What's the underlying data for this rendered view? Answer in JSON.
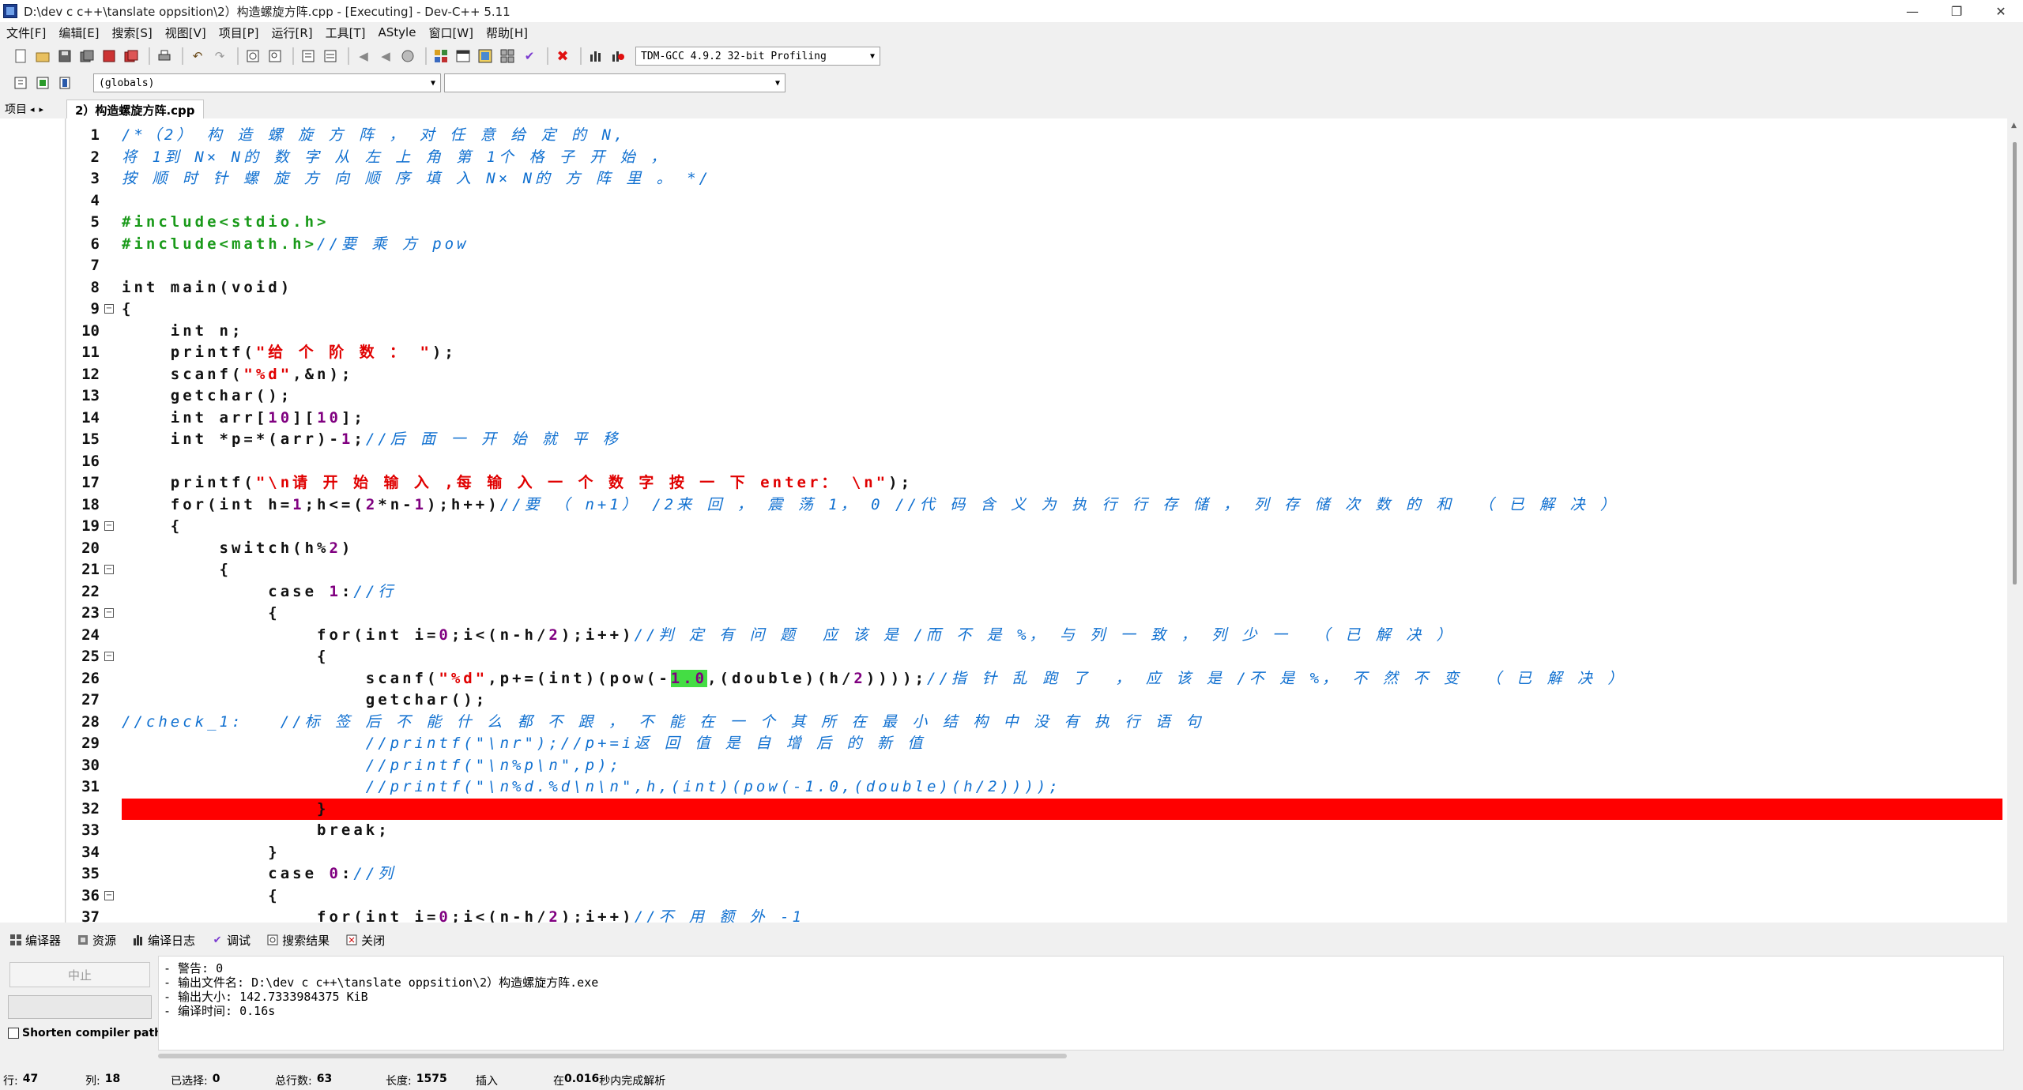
{
  "window": {
    "title": "D:\\dev c c++\\tanslate oppsition\\2）构造螺旋方阵.cpp - [Executing] - Dev-C++ 5.11",
    "minimize": "—",
    "maximize": "❐",
    "close": "✕"
  },
  "menu": [
    "文件[F]",
    "编辑[E]",
    "搜索[S]",
    "视图[V]",
    "项目[P]",
    "运行[R]",
    "工具[T]",
    "AStyle",
    "窗口[W]",
    "帮助[H]"
  ],
  "toolbar": {
    "compiler_select": "TDM-GCC 4.9.2 32-bit Profiling",
    "scope_select": "(globals)",
    "symbol_select": ""
  },
  "left_tabs": {
    "project": "项目",
    "prev": "◂",
    "next": "▸"
  },
  "editor": {
    "file_tab": "2）构造螺旋方阵.cpp",
    "error_line": 32,
    "lines": [
      {
        "n": "1",
        "html": "<span class='cm'>/*（2） 构 造 螺 旋 方 阵 ， 对 任 意 给 定 的 N,</span>"
      },
      {
        "n": "2",
        "html": "<span class='cm'>将 1到 N× N的 数 字 从 左 上 角 第 1个 格 子 开 始 ，</span>"
      },
      {
        "n": "3",
        "html": "<span class='cm'>按 顺 时 针 螺 旋 方 向 顺 序 填 入 N× N的 方 阵 里 。 */</span>"
      },
      {
        "n": "4",
        "html": ""
      },
      {
        "n": "5",
        "html": "<span class='pp'>#include&lt;stdio.h&gt;</span>"
      },
      {
        "n": "6",
        "html": "<span class='pp'>#include&lt;math.h&gt;</span><span class='cm'>//要 乘 方 pow</span>"
      },
      {
        "n": "7",
        "html": ""
      },
      {
        "n": "8",
        "html": "int main(void)"
      },
      {
        "n": "9",
        "html": "{"
      },
      {
        "n": "10",
        "html": "    int n;"
      },
      {
        "n": "11",
        "html": "    printf(<span class='str'>\"给 个 阶 数 ： \"</span>);"
      },
      {
        "n": "12",
        "html": "    scanf(<span class='str'>\"%d\"</span>,&amp;n);"
      },
      {
        "n": "13",
        "html": "    getchar();"
      },
      {
        "n": "14",
        "html": "    int arr[<span class='num'>10</span>][<span class='num'>10</span>];"
      },
      {
        "n": "15",
        "html": "    int *p=*(arr)-<span class='num'>1</span>;<span class='cm'>//后 面 一 开 始 就 平 移</span>"
      },
      {
        "n": "16",
        "html": ""
      },
      {
        "n": "17",
        "html": "    printf(<span class='str'>\"\\n请 开 始 输 入 ,每 输 入 一 个 数 字 按 一 下 enter： \\n\"</span>);"
      },
      {
        "n": "18",
        "html": "    for(int h=<span class='num'>1</span>;h&lt;=(<span class='num'>2</span>*n-<span class='num'>1</span>);h++)<span class='cm'>//要 （ n+1） /2来 回 ， 震 荡 1， 0 //代 码 含 义 为 执 行 行 存 储 ， 列 存 储 次 数 的 和  （ 已 解 决 ）</span>"
      },
      {
        "n": "19",
        "html": "    {"
      },
      {
        "n": "20",
        "html": "        switch(h%<span class='num'>2</span>)"
      },
      {
        "n": "21",
        "html": "        {"
      },
      {
        "n": "22",
        "html": "            case <span class='num'>1</span>:<span class='cm'>//行</span>"
      },
      {
        "n": "23",
        "html": "            {"
      },
      {
        "n": "24",
        "html": "                for(int i=<span class='num'>0</span>;i&lt;(n-h/<span class='num'>2</span>);i++)<span class='cm'>//判 定 有 问 题  应 该 是 /而 不 是 %， 与 列 一 致 ， 列 少 一  （ 已 解 决 ）</span>"
      },
      {
        "n": "25",
        "html": "                {"
      },
      {
        "n": "26",
        "html": "                    scanf(<span class='str'>\"%d\"</span>,p+=(int)(pow(-<span class='num' style='background:#44dd44;color:#800080;'>1.0</span>,(double)(h/<span class='num'>2</span>))));<span class='cm'>//指 针 乱 跑 了  ， 应 该 是 /不 是 %， 不 然 不 变  （ 已 解 决 ）</span>"
      },
      {
        "n": "27",
        "html": "                    getchar();"
      },
      {
        "n": "28",
        "html": "<span class='cm'>//check_1:   //标 签 后 不 能 什 么 都 不 跟 ， 不 能 在 一 个 其 所 在 最 小 结 构 中 没 有 执 行 语 句</span>"
      },
      {
        "n": "29",
        "html": "                    <span class='cm'>//printf(\"\\nr\");//p+=i返 回 值 是 自 增 后 的 新 值</span>"
      },
      {
        "n": "30",
        "html": "                    <span class='cm'>//printf(\"\\n%p\\n\",p);</span>"
      },
      {
        "n": "31",
        "html": "                    <span class='cm'>//printf(\"\\n%d.%d\\n\\n\",h,(int)(pow(-1.0,(double)(h/2))));</span>"
      },
      {
        "n": "32",
        "html": "                }"
      },
      {
        "n": "33",
        "html": "                break;"
      },
      {
        "n": "34",
        "html": "            }"
      },
      {
        "n": "35",
        "html": "            case <span class='num'>0</span>:<span class='cm'>//列</span>"
      },
      {
        "n": "36",
        "html": "            {"
      },
      {
        "n": "37",
        "html": "                for(int i=<span class='num'>0</span>;i&lt;(n-h/<span class='num'>2</span>);i++)<span class='cm'>//不 用 额 外 -1</span>"
      }
    ],
    "folds": [
      "9",
      "19",
      "21",
      "23",
      "25",
      "36"
    ]
  },
  "bottom_tabs": [
    "编译器",
    "资源",
    "编译日志",
    "调试",
    "搜索结果",
    "关闭"
  ],
  "bottom": {
    "abort": "中止",
    "shorten": "Shorten compiler paths",
    "log": [
      "- 警告: 0",
      "- 输出文件名: D:\\dev c c++\\tanslate oppsition\\2）构造螺旋方阵.exe",
      "- 输出大小: 142.7333984375 KiB",
      "- 编译时间: 0.16s"
    ]
  },
  "status": {
    "row_label": "行:",
    "row": "47",
    "col_label": "列:",
    "col": "18",
    "sel_label": "已选择:",
    "sel": "0",
    "total_label": "总行数:",
    "total": "63",
    "len_label": "长度:",
    "len": "1575",
    "mode": "插入",
    "parse_pre": "在",
    "parse_time": "0.016",
    "parse_post": "秒内完成解析"
  }
}
